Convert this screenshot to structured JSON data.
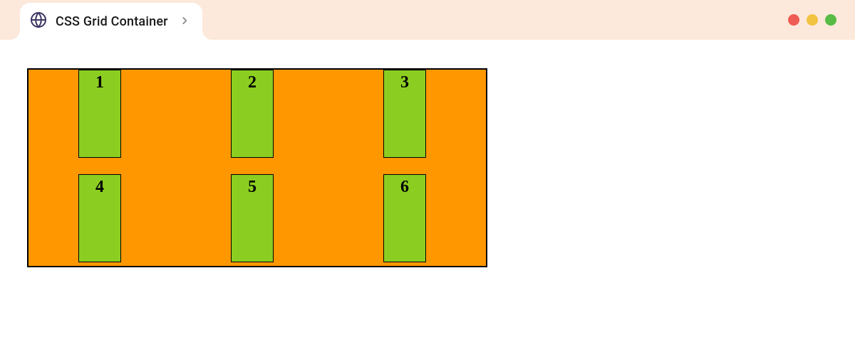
{
  "tab": {
    "title": "CSS Grid Container"
  },
  "grid": {
    "items": [
      "1",
      "2",
      "3",
      "4",
      "5",
      "6"
    ]
  },
  "colors": {
    "container": "#ff9800",
    "item": "#8bce21",
    "tabbar": "#fce9db"
  }
}
